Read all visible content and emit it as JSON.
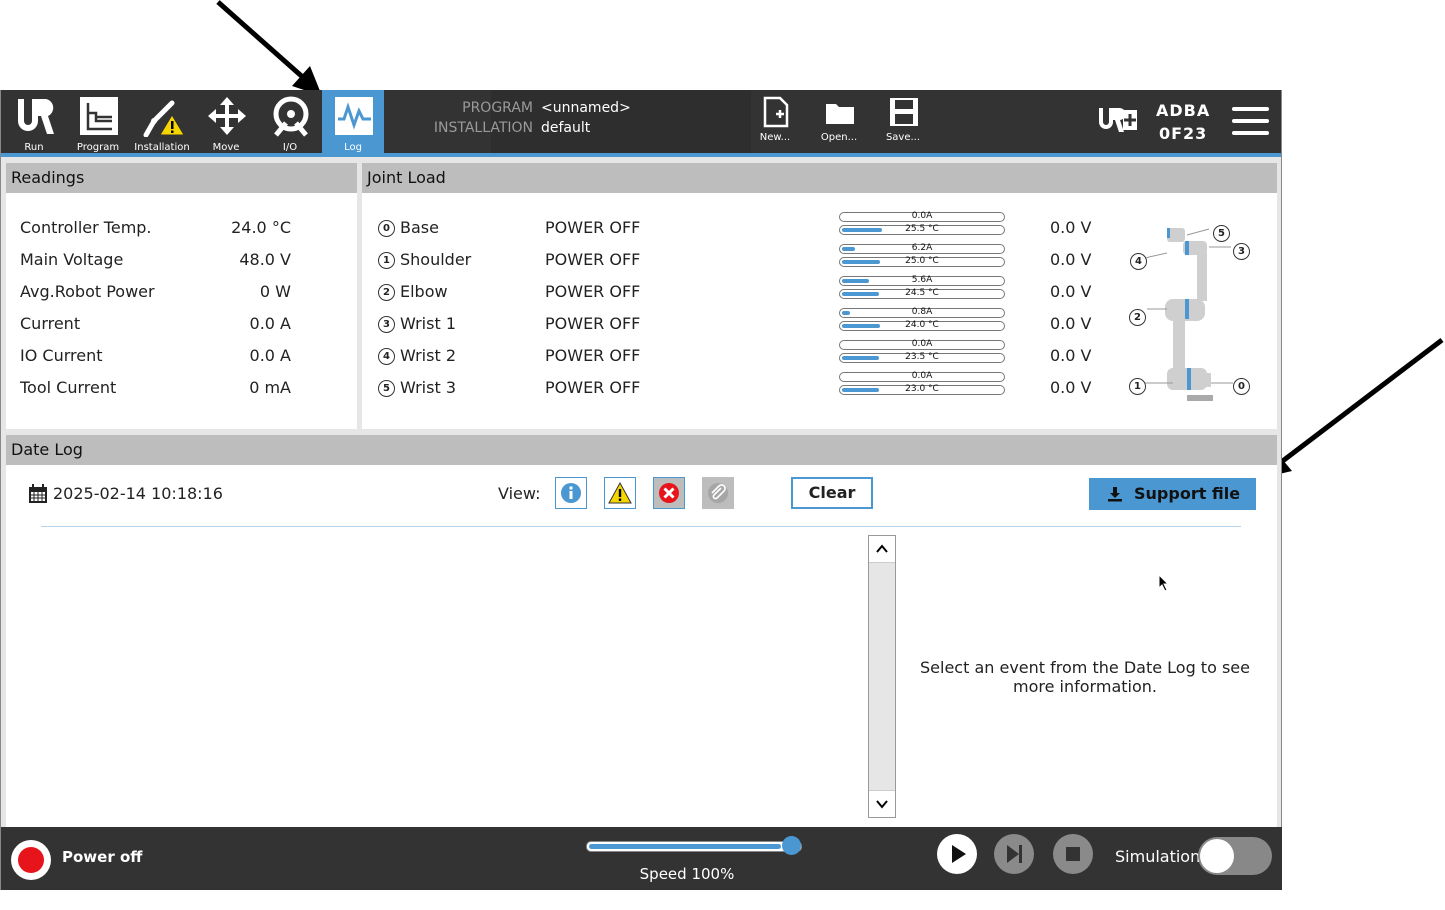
{
  "nav": {
    "items": [
      {
        "label": "Run"
      },
      {
        "label": "Program"
      },
      {
        "label": "Installation"
      },
      {
        "label": "Move"
      },
      {
        "label": "I/O"
      },
      {
        "label": "Log"
      }
    ]
  },
  "header": {
    "program_key": "PROGRAM",
    "program_value": "<unnamed>",
    "installation_key": "INSTALLATION",
    "installation_value": "default",
    "new_label": "New...",
    "open_label": "Open...",
    "save_label": "Save...",
    "robot_id_line1": "ADBA",
    "robot_id_line2": "0F23"
  },
  "readings": {
    "title": "Readings",
    "rows": [
      {
        "label": "Controller Temp.",
        "value": "24.0 °C"
      },
      {
        "label": "Main Voltage",
        "value": "48.0 V"
      },
      {
        "label": "Avg.Robot Power",
        "value": "0 W"
      },
      {
        "label": "Current",
        "value": "0.0 A"
      },
      {
        "label": "IO Current",
        "value": "0.0 A"
      },
      {
        "label": "Tool Current",
        "value": "0 mA"
      }
    ]
  },
  "joint_load": {
    "title": "Joint Load",
    "joints": [
      {
        "num": "0",
        "name": "Base",
        "state": "POWER OFF",
        "current": "0.0A",
        "current_frac": 0.0,
        "temp": "25.5 °C",
        "temp_frac": 0.25,
        "voltage": "0.0 V"
      },
      {
        "num": "1",
        "name": "Shoulder",
        "state": "POWER OFF",
        "current": "6.2A",
        "current_frac": 0.08,
        "temp": "25.0 °C",
        "temp_frac": 0.24,
        "voltage": "0.0 V"
      },
      {
        "num": "2",
        "name": "Elbow",
        "state": "POWER OFF",
        "current": "5.6A",
        "current_frac": 0.17,
        "temp": "24.5 °C",
        "temp_frac": 0.23,
        "voltage": "0.0 V"
      },
      {
        "num": "3",
        "name": "Wrist 1",
        "state": "POWER OFF",
        "current": "0.8A",
        "current_frac": 0.05,
        "temp": "24.0 °C",
        "temp_frac": 0.24,
        "voltage": "0.0 V"
      },
      {
        "num": "4",
        "name": "Wrist 2",
        "state": "POWER OFF",
        "current": "0.0A",
        "current_frac": 0.0,
        "temp": "23.5 °C",
        "temp_frac": 0.23,
        "voltage": "0.0 V"
      },
      {
        "num": "5",
        "name": "Wrist 3",
        "state": "POWER OFF",
        "current": "0.0A",
        "current_frac": 0.0,
        "temp": "23.0 °C",
        "temp_frac": 0.23,
        "voltage": "0.0 V"
      }
    ],
    "diagram_labels": [
      "0",
      "1",
      "2",
      "3",
      "4",
      "5"
    ]
  },
  "date_log": {
    "title": "Date Log",
    "datetime": "2025-02-14 10:18:16",
    "view_label": "View:",
    "clear_label": "Clear",
    "support_label": "Support file",
    "detail_text": "Select an event from the Date Log to see more information."
  },
  "footer": {
    "power_label": "Power off",
    "speed_label": "Speed 100%",
    "speed_value": 1.0,
    "simulation_label": "Simulation"
  },
  "colors": {
    "accent": "#4b97d2",
    "bar_dark": "#333333",
    "power_red": "#e8141b"
  }
}
